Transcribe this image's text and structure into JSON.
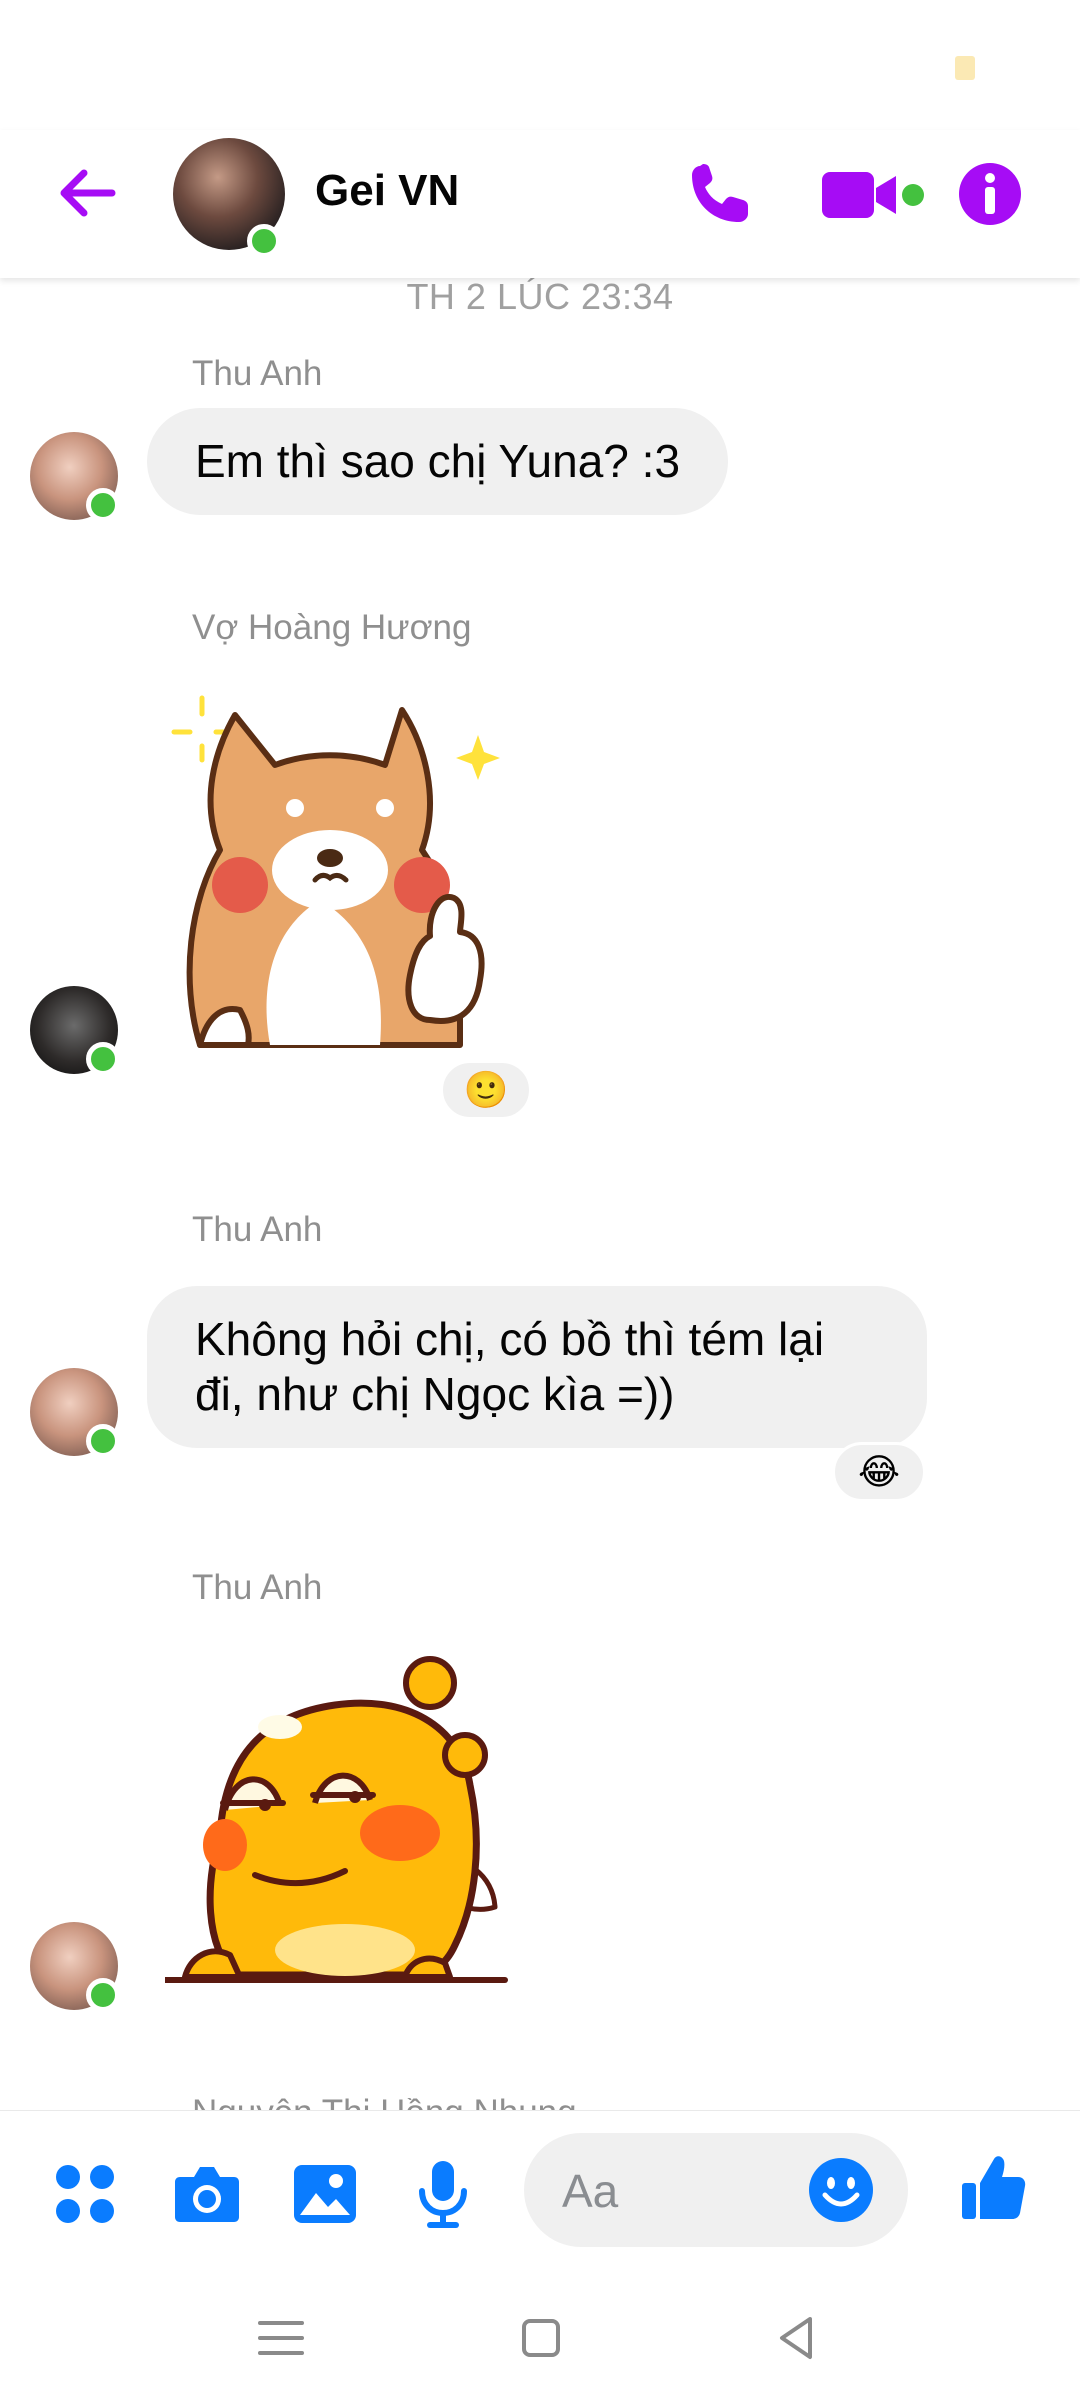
{
  "header": {
    "contact_name": "Gei VN"
  },
  "colors": {
    "header_accent": "#a60cf5",
    "composer_accent": "#0a7cff",
    "bubble_bg": "#f0f0f0",
    "presence": "#44c13f"
  },
  "thread": {
    "timestamp": "TH 2 LÚC 23:34",
    "messages": [
      {
        "sender": "Thu Anh",
        "text": "Em thì sao chị Yuna? :3"
      },
      {
        "sender": "Vợ Hoàng Hương",
        "sticker": "shiba-thumbs-up-sticker",
        "reaction": "🙂"
      },
      {
        "sender": "Thu Anh",
        "text_line1": "Không hỏi chị, có bồ thì tém lại",
        "text_line2": "đi, như chị Ngọc kìa =))",
        "reaction": "😂"
      },
      {
        "sender": "Thu Anh",
        "sticker": "yellow-chick-sticker"
      }
    ],
    "cutoff_sender": "Nguyễn Thị Hồng Nhung"
  },
  "composer": {
    "placeholder": "Aa",
    "icons": [
      "apps-icon",
      "camera-icon",
      "gallery-icon",
      "microphone-icon",
      "emoji-icon",
      "thumbs-up-icon"
    ]
  },
  "nav_bar": {
    "icons": [
      "menu-icon",
      "home-icon",
      "back-icon"
    ]
  }
}
